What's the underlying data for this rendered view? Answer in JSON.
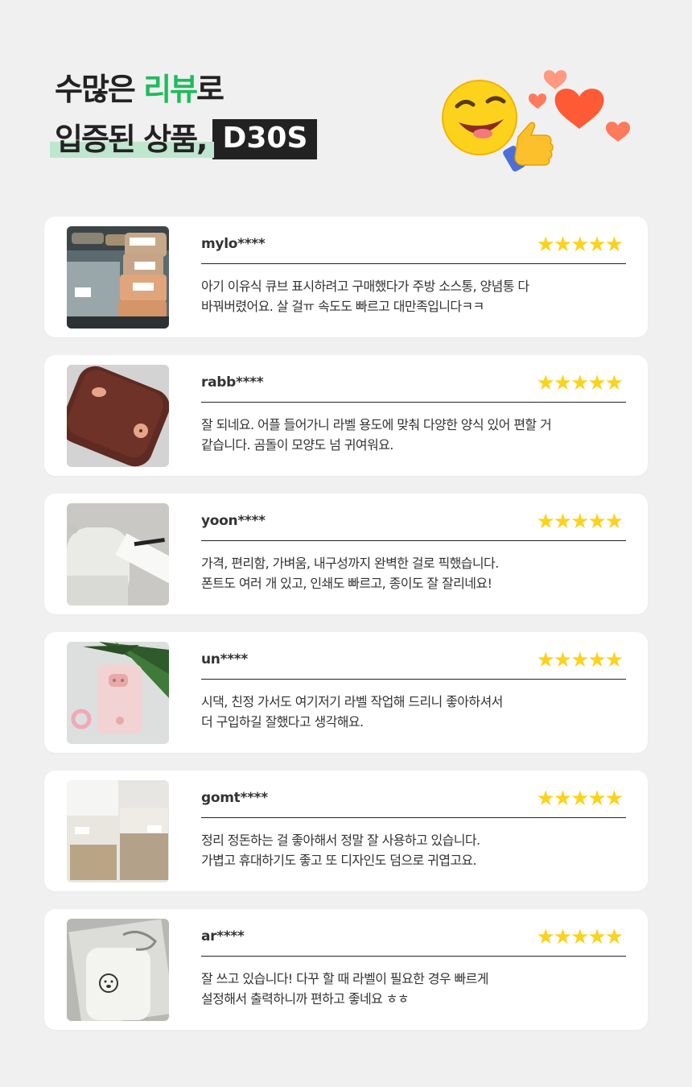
{
  "header": {
    "line1_pre": "수많은 ",
    "line1_highlight": "리뷰",
    "line1_post": "로",
    "line2": "입증된 상품,",
    "model": "D30S"
  },
  "colors": {
    "accent_green": "#1fbb5c",
    "star": "#fcd21d",
    "badge_bg": "#222222"
  },
  "icons": [
    "winking-emoji-icon",
    "thumbs-up-icon",
    "heart-icon",
    "star-icon"
  ],
  "reviews": [
    {
      "user": "mylo****",
      "stars": "★★★★★",
      "rating": 5,
      "text1": "아기 이유식 큐브 표시하려고 구매했다가 주방 소스통, 양념통 다",
      "text2": "바꿔버렸어요. 살  걸ㅠ 속도도 빠르고 대만족입니다ㅋㅋ"
    },
    {
      "user": "rabb****",
      "stars": "★★★★★",
      "rating": 5,
      "text1": "잘 되네요. 어플 들어가니 라벨 용도에 맞춰 다양한 양식 있어 편할 거",
      "text2": "같습니다. 곰돌이 모양도 넘 귀여워요."
    },
    {
      "user": "yoon****",
      "stars": "★★★★★",
      "rating": 5,
      "text1": "가격, 편리함, 가벼움, 내구성까지 완벽한 걸로 픽했습니다.",
      "text2": "폰트도 여러 개 있고, 인쇄도 빠르고, 종이도 잘 잘리네요!"
    },
    {
      "user": "un****",
      "stars": "★★★★★",
      "rating": 5,
      "text1": "시댁, 친정 가서도 여기저기 라벨 작업해 드리니 좋아하셔서",
      "text2": "더 구입하길 잘했다고 생각해요."
    },
    {
      "user": "gomt****",
      "stars": "★★★★★",
      "rating": 5,
      "text1": "정리 정돈하는 걸 좋아해서 정말 잘 사용하고 있습니다.",
      "text2": "가볍고 휴대하기도 좋고 또 디자인도 덤으로 귀엽고요."
    },
    {
      "user": "ar****",
      "stars": "★★★★★",
      "rating": 5,
      "text1": "잘 쓰고 있습니다! 다꾸 할 때 라벨이 필요한 경우 빠르게",
      "text2": "설정해서 출력하니까 편하고 좋네요 ㅎㅎ"
    }
  ]
}
